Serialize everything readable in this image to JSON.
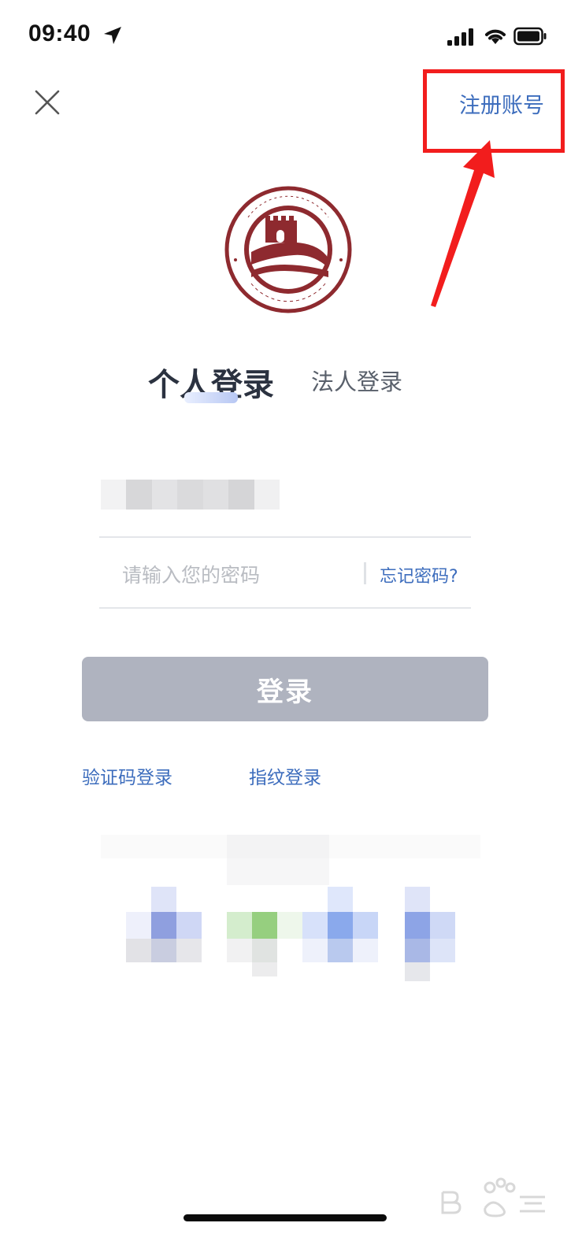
{
  "status_bar": {
    "time": "09:40"
  },
  "top_bar": {
    "register_label": "注册账号"
  },
  "tabs": [
    {
      "label": "个人登录",
      "active": true
    },
    {
      "label": "法人登录",
      "active": false
    }
  ],
  "form": {
    "password_placeholder": "请输入您的密码",
    "forgot_label": "忘记密码?"
  },
  "login_button": {
    "label": "登录"
  },
  "alt_login": {
    "sms_label": "验证码登录",
    "fingerprint_label": "指纹登录"
  },
  "colors": {
    "link_blue": "#3d6dbd",
    "button_gray": "#afb3bf",
    "logo_red": "#8e2a2f",
    "annotation_red": "#f21d1d"
  },
  "icons": [
    "location-arrow-icon",
    "signal-icon",
    "wifi-icon",
    "battery-icon",
    "close-icon"
  ]
}
